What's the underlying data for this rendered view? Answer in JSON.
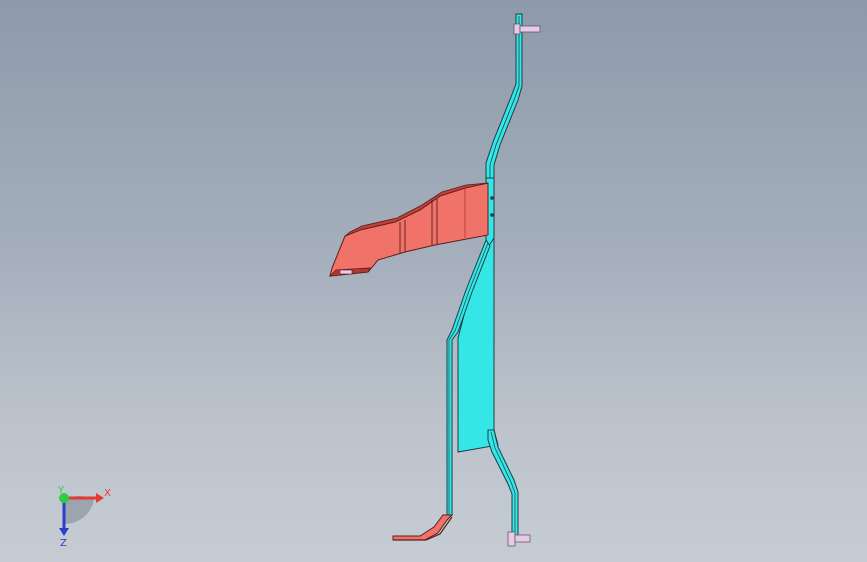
{
  "viewport": {
    "background_top": "#8e9aaa",
    "background_bottom": "#c6ccd3"
  },
  "model": {
    "bracket_color": "#35e6e6",
    "arm_color": "#f07268",
    "edge_color": "#1b3f46",
    "bolt_color": "#e8c9e6"
  },
  "triad": {
    "x_label": "X",
    "y_label": "Y",
    "z_label": "Z",
    "x_color": "#e53935",
    "y_color": "#2ecc40",
    "z_color": "#2a3fc8"
  }
}
